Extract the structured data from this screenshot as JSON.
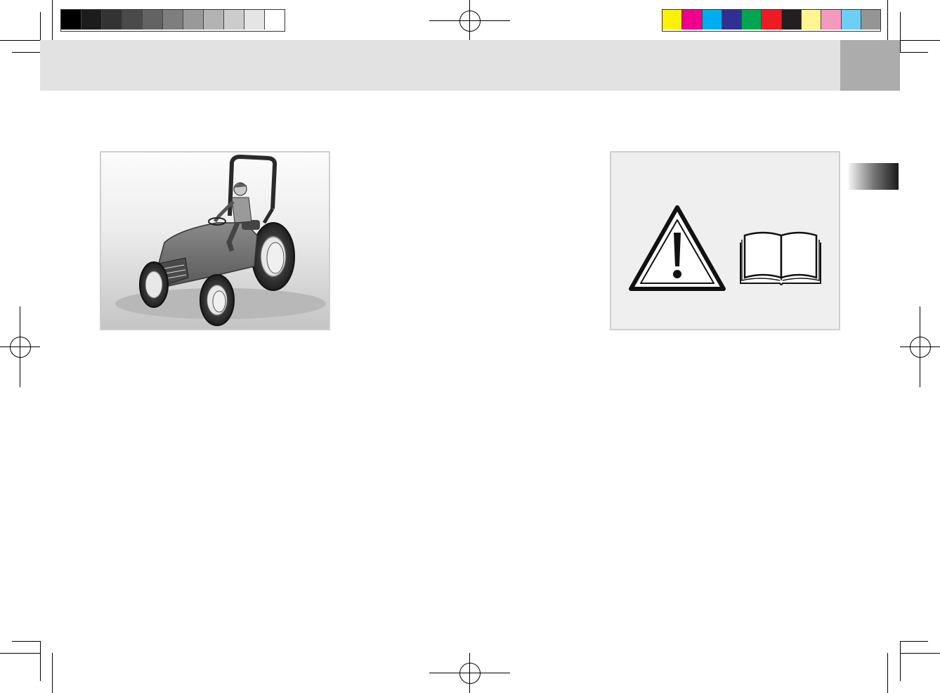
{
  "print_marks": {
    "grayscale_bar": [
      "#000000",
      "#1c1c1c",
      "#333333",
      "#4a4a4a",
      "#636363",
      "#7e7e7e",
      "#999999",
      "#b3b3b3",
      "#cccccc",
      "#e5e5e5",
      "#ffffff"
    ],
    "color_bar": [
      "#fff200",
      "#ec008c",
      "#00aeef",
      "#2e3192",
      "#00a651",
      "#ed1c24",
      "#231f20",
      "#fff68f",
      "#f49ac1",
      "#6dcff6",
      "#959595"
    ]
  },
  "header": {
    "band_color": "#e2e2e2",
    "tab_color": "#acacac"
  },
  "figures": {
    "tractor": {
      "icon": "tractor-with-operator-illustration"
    },
    "safety": {
      "icons": [
        "warning-triangle-icon",
        "open-book-icon"
      ]
    }
  }
}
